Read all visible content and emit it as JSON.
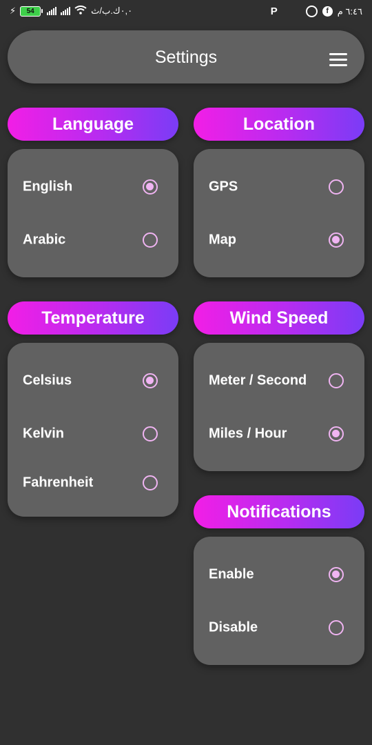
{
  "status_bar": {
    "battery": "54",
    "carrier_text": "٠,٠ك.ب/ث",
    "p_icon": "P",
    "time": "٦:٤٦ م",
    "facebook_glyph": "f"
  },
  "app_bar": {
    "title": "Settings",
    "menu_icon": "hamburger-menu-icon"
  },
  "sections": {
    "language": {
      "title": "Language",
      "options": [
        {
          "label": "English",
          "selected": true
        },
        {
          "label": "Arabic",
          "selected": false
        }
      ]
    },
    "location": {
      "title": "Location",
      "options": [
        {
          "label": "GPS",
          "selected": false
        },
        {
          "label": "Map",
          "selected": true
        }
      ]
    },
    "temperature": {
      "title": "Temperature",
      "options": [
        {
          "label": "Celsius",
          "selected": true
        },
        {
          "label": "Kelvin",
          "selected": false
        },
        {
          "label": "Fahrenheit",
          "selected": false
        }
      ]
    },
    "wind_speed": {
      "title": "Wind Speed",
      "options": [
        {
          "label": "Meter / Second",
          "selected": false
        },
        {
          "label": "Miles / Hour",
          "selected": true
        }
      ]
    },
    "notifications": {
      "title": "Notifications",
      "options": [
        {
          "label": "Enable",
          "selected": true
        },
        {
          "label": "Disable",
          "selected": false
        }
      ]
    }
  },
  "colors": {
    "background": "#303030",
    "card": "#616161",
    "pill_gradient_start": "#f21ee6",
    "pill_gradient_end": "#7a3cf6",
    "radio_accent": "#f0b4f2"
  }
}
